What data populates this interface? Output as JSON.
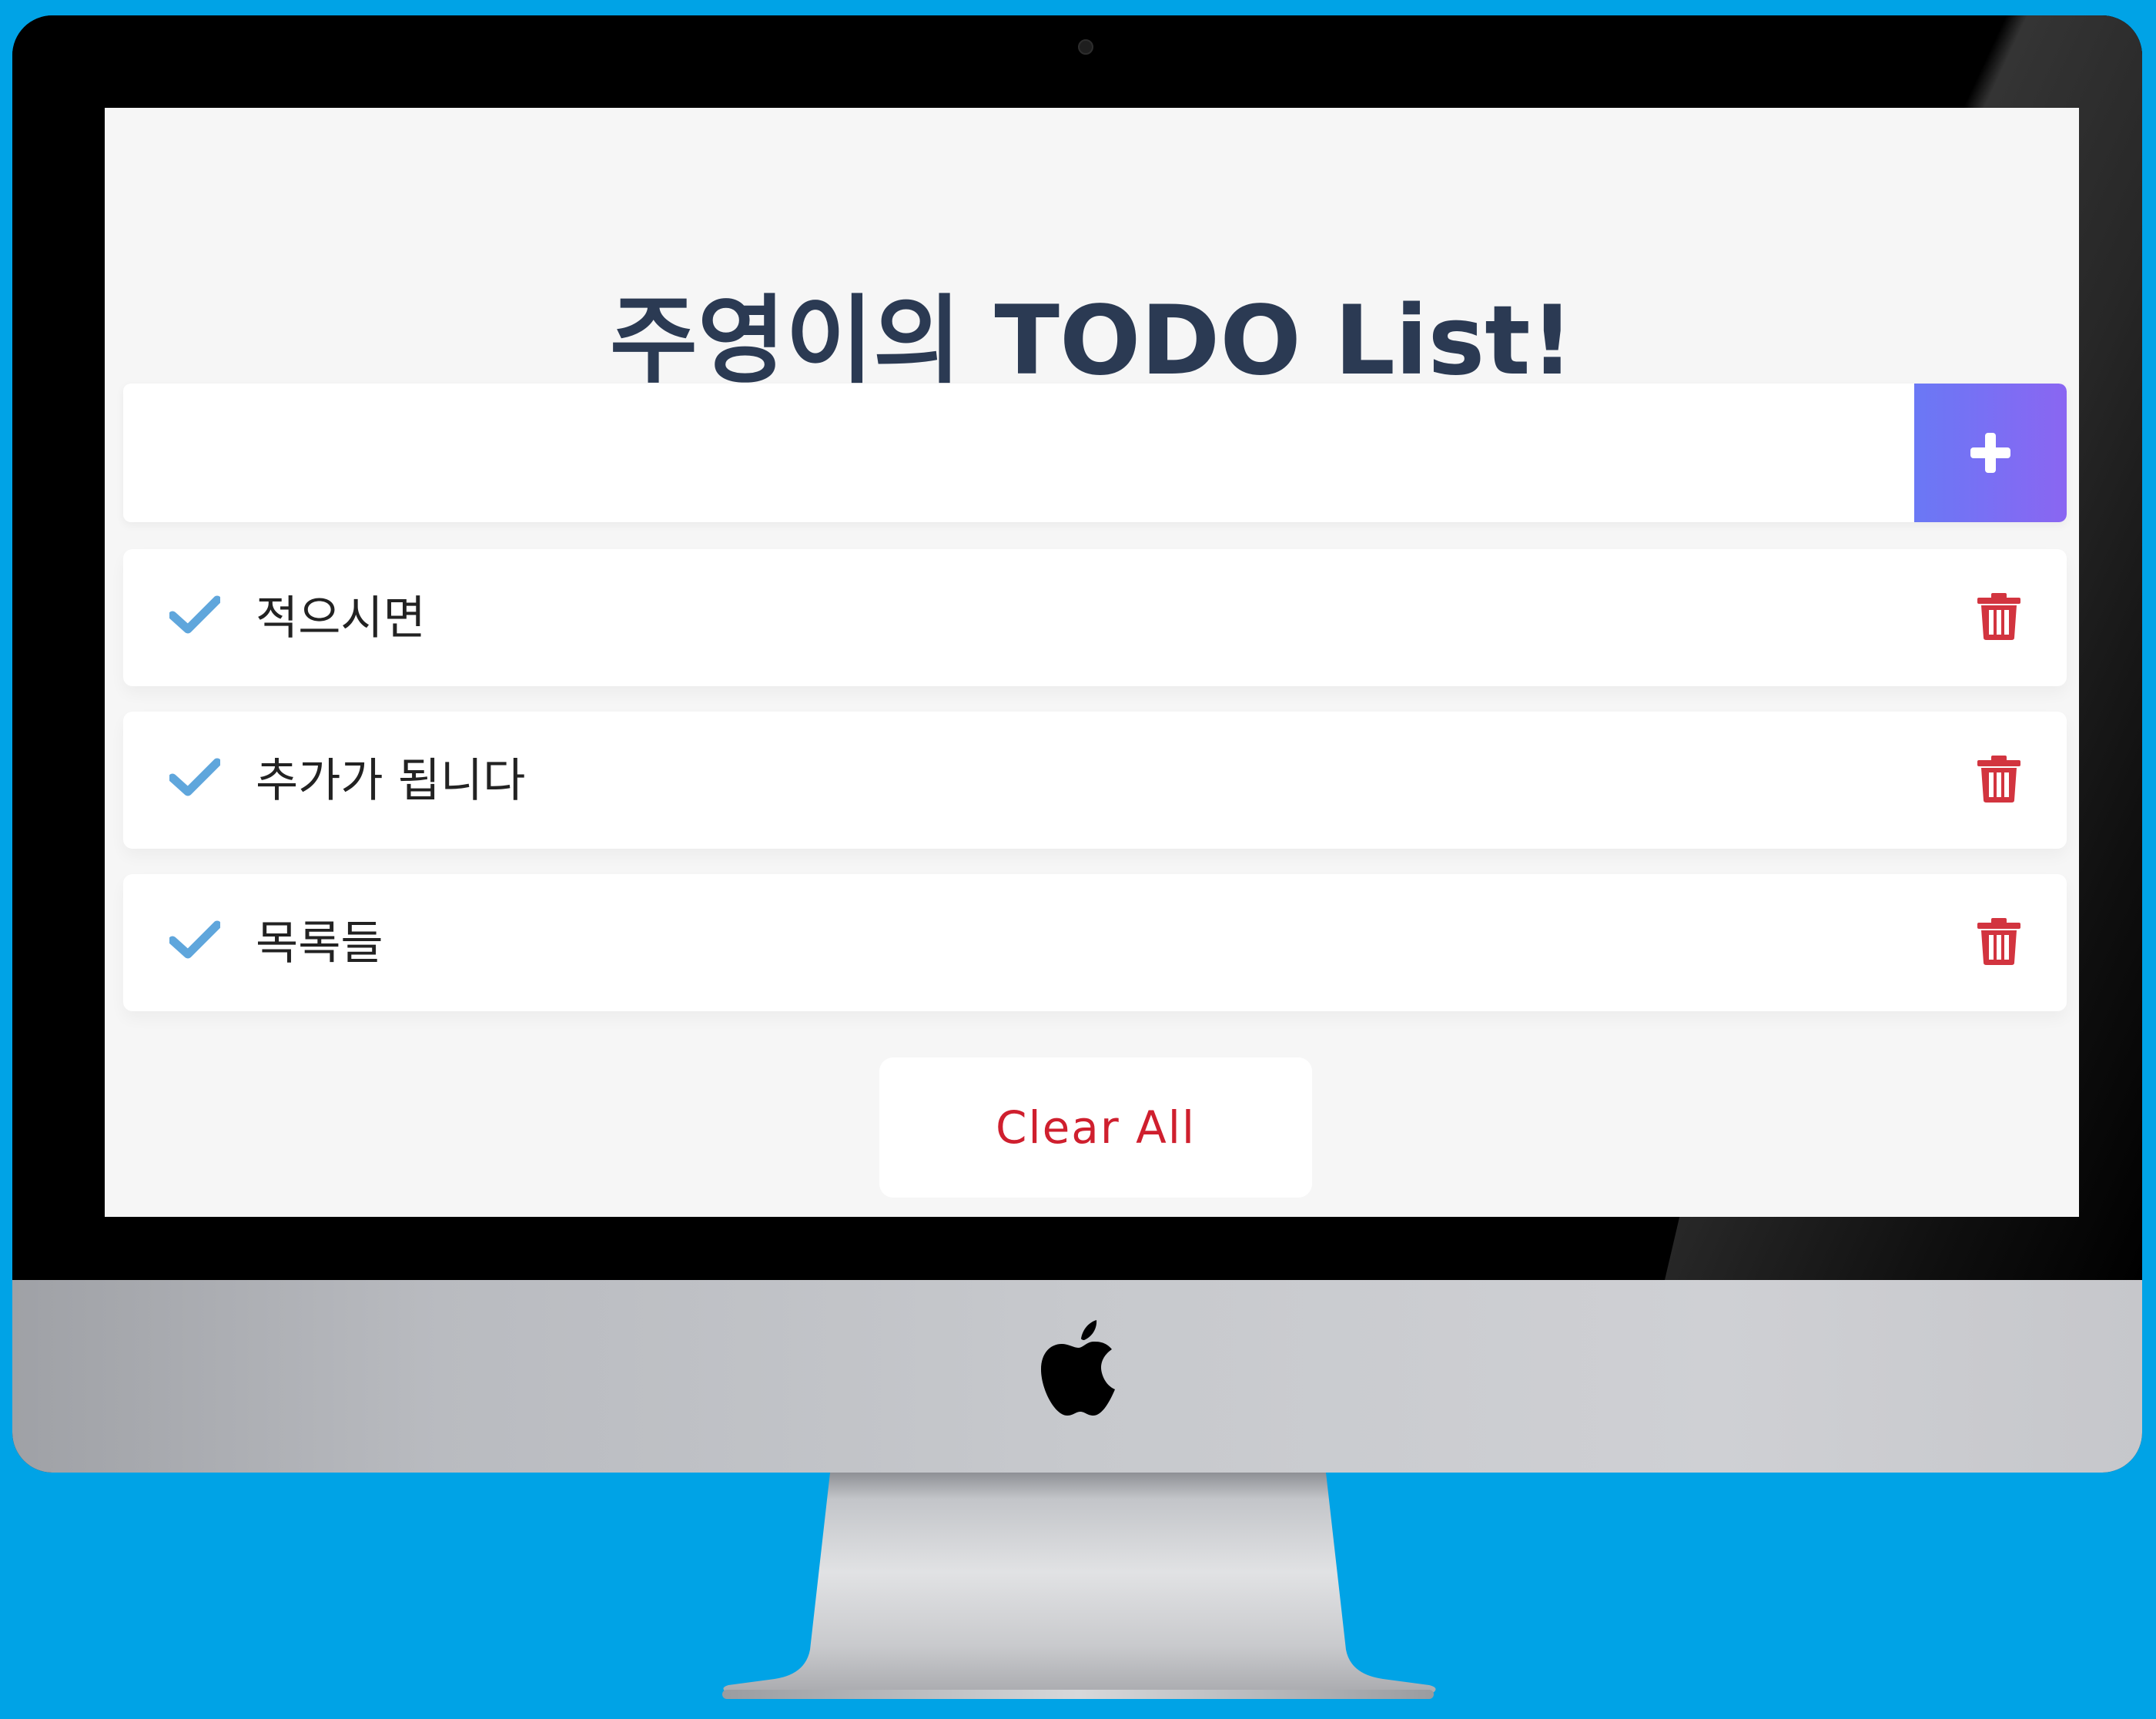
{
  "app": {
    "title": "주영이의 TODO List!"
  },
  "input": {
    "value": "",
    "placeholder": ""
  },
  "add_button": {
    "icon": "plus-icon"
  },
  "todos": [
    {
      "text": "적으시면",
      "check_icon": "check-icon",
      "delete_icon": "trash-icon"
    },
    {
      "text": "추가가 됩니다",
      "check_icon": "check-icon",
      "delete_icon": "trash-icon"
    },
    {
      "text": "목록들",
      "check_icon": "check-icon",
      "delete_icon": "trash-icon"
    }
  ],
  "footer": {
    "clear_label": "Clear All"
  },
  "colors": {
    "background": "#00a3e6",
    "screen": "#f6f6f6",
    "title": "#2b3a53",
    "accent_start": "#6a78f5",
    "accent_end": "#8a66f2",
    "check": "#5fa6dc",
    "trash": "#d2343f",
    "clear_text": "#cf1f2e"
  }
}
